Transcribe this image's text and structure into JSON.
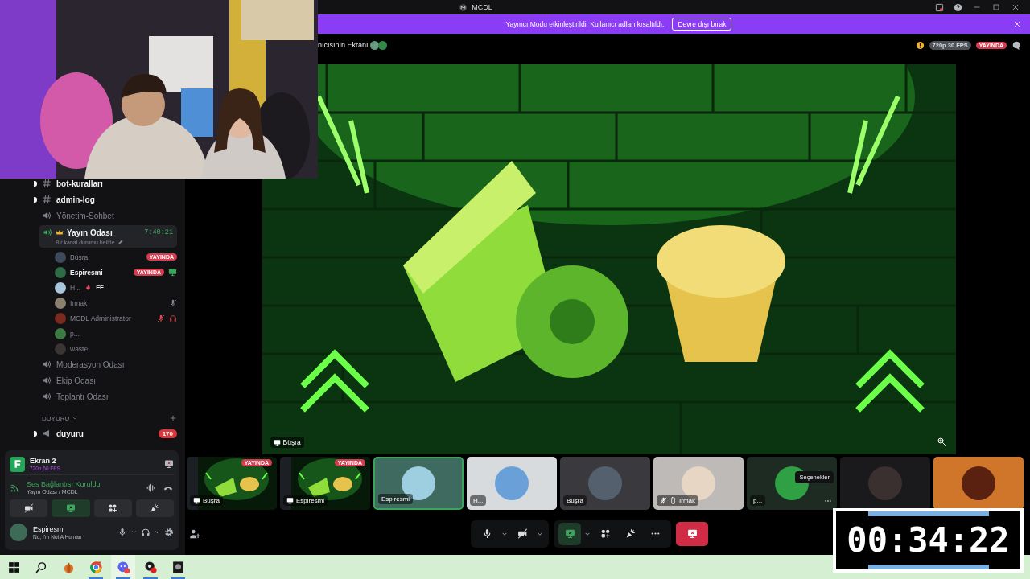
{
  "window": {
    "title": "MCDL"
  },
  "banner": {
    "message": "Yayıncı Modu etkinleştirildi. Kullanıcı adları kısaltıldı.",
    "button": "Devre dışı bırak"
  },
  "stream_header": {
    "title": "nıcısının Ekranı",
    "warning": true,
    "quality": "720p 30 FPS",
    "live_badge": "YAYINDA"
  },
  "channels": [
    {
      "kind": "text",
      "name": "bot-kuralları",
      "unread": true,
      "selected": false
    },
    {
      "kind": "text",
      "name": "admin-log",
      "unread": true,
      "selected": false
    },
    {
      "kind": "voice",
      "name": "Yönetim-Sohbet",
      "selected": false
    },
    {
      "kind": "voice",
      "name": "Yayın Odası",
      "selected": true,
      "time": "7:40:21",
      "status_hint": "Bir kanal durumu belirle",
      "members": [
        {
          "name": "Büşra",
          "self": false,
          "badge": "YAYINDA",
          "video": false,
          "muted": false,
          "server_muted": false
        },
        {
          "name": "Espiresmi",
          "self": true,
          "badge": "YAYINDA",
          "video": true,
          "muted": false,
          "server_muted": false
        },
        {
          "name": "H...",
          "self": false,
          "tag": "FF",
          "video": false,
          "muted": false,
          "server_muted": false
        },
        {
          "name": "Irmak",
          "self": false,
          "video": false,
          "muted": true,
          "server_muted": false
        },
        {
          "name": "MCDL Administrator",
          "self": false,
          "video": false,
          "muted": false,
          "server_muted": true
        },
        {
          "name": "p...",
          "self": false,
          "video": false,
          "muted": false,
          "server_muted": false
        },
        {
          "name": "waste",
          "self": false,
          "video": false,
          "muted": false,
          "server_muted": false
        }
      ]
    },
    {
      "kind": "voice",
      "name": "Moderasyon Odası",
      "selected": false
    },
    {
      "kind": "voice",
      "name": "Ekip Odası",
      "selected": false
    },
    {
      "kind": "voice",
      "name": "Toplantı Odası",
      "selected": false
    },
    {
      "kind": "category",
      "name": "DUYURU"
    },
    {
      "kind": "announcement",
      "name": "duyuru",
      "unread": true,
      "selected": false,
      "badge": "170"
    }
  ],
  "stream": {
    "kind": "picture",
    "streamer": "Büşra"
  },
  "participants": [
    {
      "kind": "stream",
      "name": "Büşra",
      "badge": "YAYINDA",
      "selected": false
    },
    {
      "kind": "stream",
      "name": "Espiresmi",
      "badge": "YAYINDA",
      "selected": false
    },
    {
      "kind": "avatar",
      "name": "Espiresmi",
      "selected": true
    },
    {
      "kind": "avatar",
      "name": "H...",
      "selected": false
    },
    {
      "kind": "avatar",
      "name": "Büşra",
      "selected": false
    },
    {
      "kind": "avatar",
      "name": "Irmak",
      "muted": true,
      "mobile": true,
      "selected": false
    },
    {
      "kind": "avatar",
      "name": "p...",
      "tooltip": "Seçenekler",
      "selected": false
    },
    {
      "kind": "avatar",
      "selected": false
    },
    {
      "kind": "avatar",
      "selected": false
    }
  ],
  "control_groups": [
    {
      "items": [
        {
          "kind": "mic",
          "caret": true
        },
        {
          "kind": "camera_off",
          "caret": true
        }
      ]
    },
    {
      "items": [
        {
          "kind": "screen_share",
          "caret": true,
          "on": true
        },
        {
          "kind": "activities"
        },
        {
          "kind": "soundboard"
        },
        {
          "kind": "more"
        }
      ]
    },
    {
      "items": [
        {
          "kind": "leave"
        }
      ]
    }
  ],
  "screen_share": {
    "title": "Ekran 2",
    "quality": "720p 60 FPS"
  },
  "voice_status": {
    "title": "Ses Bağlantısı Kuruldu",
    "location": "Yayın Odası / MCDL"
  },
  "voice_buttons": [
    {
      "kind": "camera_off",
      "on": false
    },
    {
      "kind": "screen_share",
      "on": true
    },
    {
      "kind": "activities",
      "on": false
    },
    {
      "kind": "soundboard",
      "on": false
    }
  ],
  "user": {
    "name": "Espiresmi",
    "status": "No, I'm Not A Human"
  },
  "timer": "00:34:22",
  "taskbar": [
    {
      "kind": "start",
      "selected": false,
      "running": false
    },
    {
      "kind": "search",
      "selected": false,
      "running": false
    },
    {
      "kind": "fruit",
      "selected": false,
      "running": false
    },
    {
      "kind": "browser",
      "selected": false,
      "running": true
    },
    {
      "kind": "chat",
      "selected": true,
      "running": true
    },
    {
      "kind": "record",
      "selected": false,
      "running": true
    },
    {
      "kind": "game",
      "selected": false,
      "running": true
    }
  ]
}
